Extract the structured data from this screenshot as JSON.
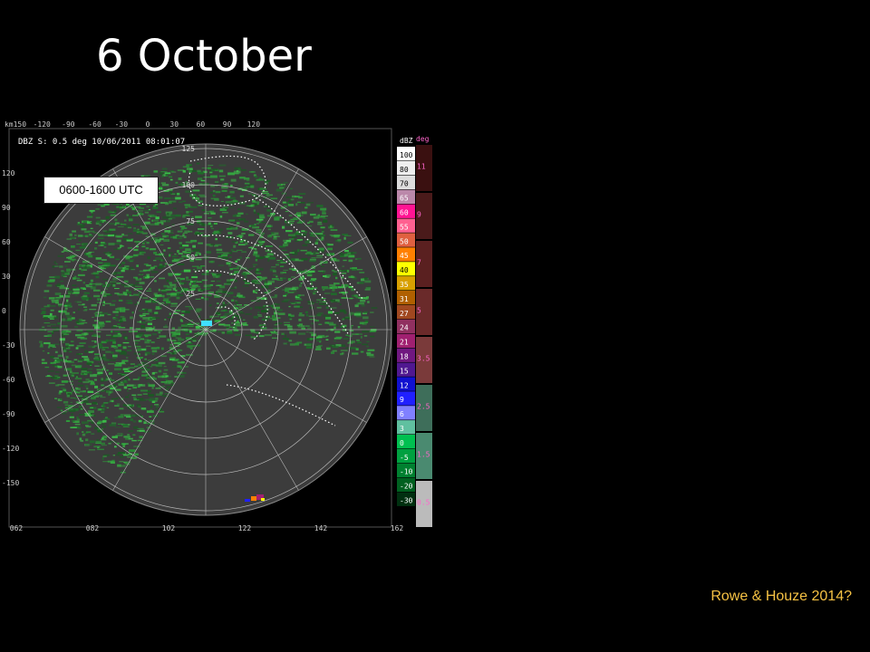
{
  "slide": {
    "title": "6 October",
    "time_label": "0600-1600 UTC",
    "citation": "Rowe & Houze 2014?"
  },
  "radar": {
    "header": "DBZ S: 0.5 deg 10/06/2011 08:01:07",
    "x_ticks": [
      "km150",
      "-120",
      "-90",
      "-60",
      "-30",
      "0",
      "30",
      "60",
      "90",
      "120"
    ],
    "y_ticks": [
      "120",
      "90",
      "60",
      "30",
      "0",
      "-30",
      "-60",
      "-90",
      "-120",
      "-150"
    ],
    "bottom_ticks": [
      "062",
      "082",
      "102",
      "122",
      "142",
      "162"
    ],
    "ring_labels": [
      "25",
      "50",
      "75",
      "100",
      "125"
    ],
    "colorbar_unit": "dBZ",
    "colorbar_levels": [
      {
        "label": "100",
        "color": "#ffffff"
      },
      {
        "label": "80",
        "color": "#eeeeee"
      },
      {
        "label": "70",
        "color": "#dddddd"
      },
      {
        "label": "65",
        "color": "#bb88aa"
      },
      {
        "label": "60",
        "color": "#ff1493"
      },
      {
        "label": "55",
        "color": "#ff6090"
      },
      {
        "label": "50",
        "color": "#e06040"
      },
      {
        "label": "45",
        "color": "#ff8000"
      },
      {
        "label": "40",
        "color": "#ffff00"
      },
      {
        "label": "35",
        "color": "#d8a000"
      },
      {
        "label": "31",
        "color": "#b06000"
      },
      {
        "label": "27",
        "color": "#a04820"
      },
      {
        "label": "24",
        "color": "#903060"
      },
      {
        "label": "21",
        "color": "#a02070"
      },
      {
        "label": "18",
        "color": "#701880"
      },
      {
        "label": "15",
        "color": "#501890"
      },
      {
        "label": "12",
        "color": "#1010d0"
      },
      {
        "label": "9",
        "color": "#2020ff"
      },
      {
        "label": "6",
        "color": "#8080ff"
      },
      {
        "label": "3",
        "color": "#60c0a0"
      },
      {
        "label": "0",
        "color": "#00c050"
      },
      {
        "label": "-5",
        "color": "#00a040"
      },
      {
        "label": "-10",
        "color": "#008030"
      },
      {
        "label": "-20",
        "color": "#006020"
      },
      {
        "label": "-30",
        "color": "#003010"
      }
    ],
    "elevation_unit": "deg",
    "elevation_labels": [
      "11",
      "9",
      "7",
      "5",
      "3.5",
      "2.5",
      "1.5",
      "0.5"
    ]
  }
}
